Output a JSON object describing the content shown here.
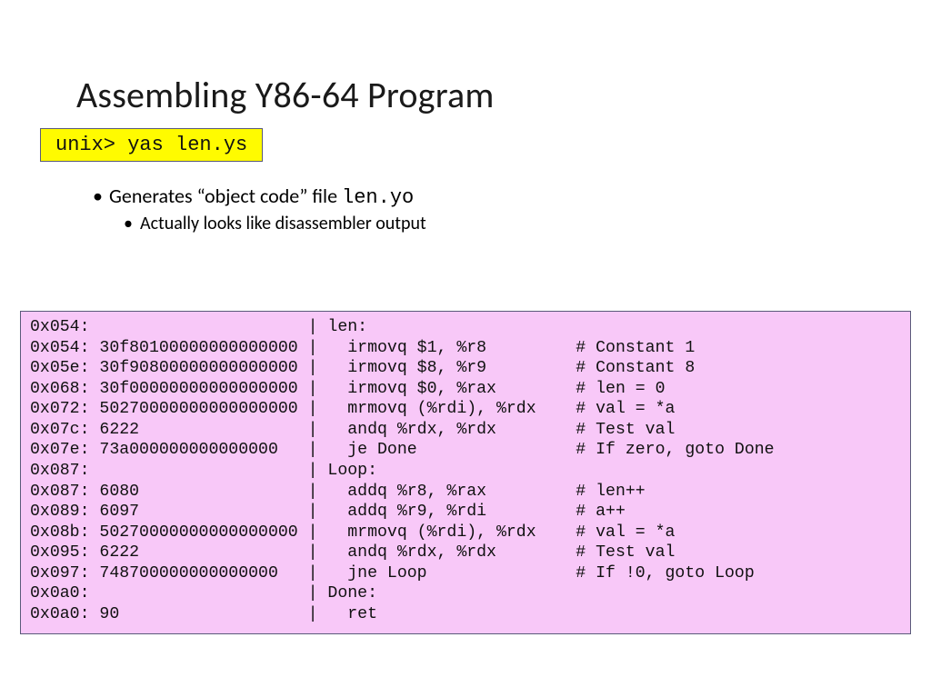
{
  "title": "Assembling Y86-64 Program",
  "cmd": "unix> yas len.ys",
  "bullet1_prefix": "Generates “object code” file ",
  "bullet1_code": "len.yo",
  "bullet2": "Actually looks like disassembler output",
  "code_lines": [
    "0x054:                      | len:",
    "0x054: 30f80100000000000000 |   irmovq $1, %r8         # Constant 1",
    "0x05e: 30f90800000000000000 |   irmovq $8, %r9         # Constant 8",
    "0x068: 30f00000000000000000 |   irmovq $0, %rax        # len = 0",
    "0x072: 50270000000000000000 |   mrmovq (%rdi), %rdx    # val = *a",
    "0x07c: 6222                 |   andq %rdx, %rdx        # Test val",
    "0x07e: 73a000000000000000   |   je Done                # If zero, goto Done",
    "0x087:                      | Loop:",
    "0x087: 6080                 |   addq %r8, %rax         # len++",
    "0x089: 6097                 |   addq %r9, %rdi         # a++",
    "0x08b: 50270000000000000000 |   mrmovq (%rdi), %rdx    # val = *a",
    "0x095: 6222                 |   andq %rdx, %rdx        # Test val",
    "0x097: 748700000000000000   |   jne Loop               # If !0, goto Loop",
    "0x0a0:                      | Done:",
    "0x0a0: 90                   |   ret"
  ]
}
